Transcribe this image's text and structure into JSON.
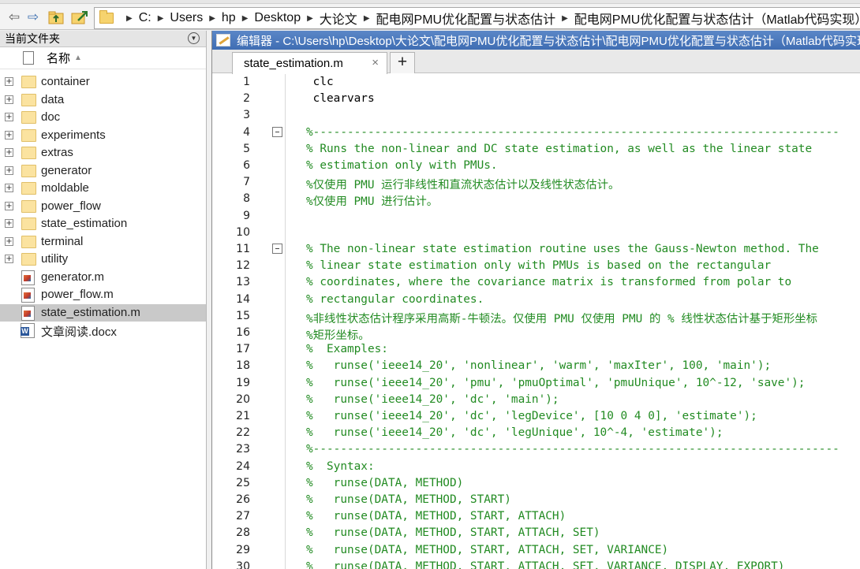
{
  "address_bar": {
    "crumbs": [
      "C:",
      "Users",
      "hp",
      "Desktop",
      "大论文",
      "配电网PMU优化配置与状态估计",
      "配电网PMU优化配置与状态估计（Matlab代码实现）"
    ]
  },
  "file_browser": {
    "title": "当前文件夹",
    "column_name": "名称",
    "items": [
      {
        "name": "container",
        "kind": "folder"
      },
      {
        "name": "data",
        "kind": "folder"
      },
      {
        "name": "doc",
        "kind": "folder"
      },
      {
        "name": "experiments",
        "kind": "folder"
      },
      {
        "name": "extras",
        "kind": "folder"
      },
      {
        "name": "generator",
        "kind": "folder"
      },
      {
        "name": "moldable",
        "kind": "folder"
      },
      {
        "name": "power_flow",
        "kind": "folder"
      },
      {
        "name": "state_estimation",
        "kind": "folder"
      },
      {
        "name": "terminal",
        "kind": "folder"
      },
      {
        "name": "utility",
        "kind": "folder"
      },
      {
        "name": "generator.m",
        "kind": "mfile"
      },
      {
        "name": "power_flow.m",
        "kind": "mfile"
      },
      {
        "name": "state_estimation.m",
        "kind": "mfile",
        "selected": true
      },
      {
        "name": "文章阅读.docx",
        "kind": "docx"
      }
    ]
  },
  "editor": {
    "title": "编辑器 - C:\\Users\\hp\\Desktop\\大论文\\配电网PMU优化配置与状态估计\\配电网PMU优化配置与状态估计（Matlab代码实现）",
    "tab_label": "state_estimation.m",
    "tab_close": "×",
    "tab_add": "+",
    "lines": [
      {
        "n": "1",
        "text": " clc",
        "comment": false
      },
      {
        "n": "2",
        "text": " clearvars",
        "comment": false
      },
      {
        "n": "3",
        "text": "",
        "comment": false
      },
      {
        "n": "4",
        "text": "%-----------------------------------------------------------------------------",
        "comment": true,
        "fold": true
      },
      {
        "n": "5",
        "text": "% Runs the non-linear and DC state estimation, as well as the linear state",
        "comment": true
      },
      {
        "n": "6",
        "text": "% estimation only with PMUs.",
        "comment": true
      },
      {
        "n": "7",
        "text": "%仅使用 PMU 运行非线性和直流状态估计以及线性状态估计。",
        "comment": true
      },
      {
        "n": "8",
        "text": "%仅使用 PMU 进行估计。",
        "comment": true
      },
      {
        "n": "9",
        "text": "",
        "comment": false
      },
      {
        "n": "10",
        "text": "",
        "comment": false
      },
      {
        "n": "11",
        "text": "% The non-linear state estimation routine uses the Gauss-Newton method. The",
        "comment": true,
        "fold": true
      },
      {
        "n": "12",
        "text": "% linear state estimation only with PMUs is based on the rectangular",
        "comment": true
      },
      {
        "n": "13",
        "text": "% coordinates, where the covariance matrix is transformed from polar to",
        "comment": true
      },
      {
        "n": "14",
        "text": "% rectangular coordinates.",
        "comment": true
      },
      {
        "n": "15",
        "text": "%非线性状态估计程序采用高斯-牛顿法。仅使用 PMU 仅使用 PMU 的 % 线性状态估计基于矩形坐标",
        "comment": true
      },
      {
        "n": "16",
        "text": "%矩形坐标。",
        "comment": true
      },
      {
        "n": "17",
        "text": "%  Examples:",
        "comment": true
      },
      {
        "n": "18",
        "text": "%   runse('ieee14_20', 'nonlinear', 'warm', 'maxIter', 100, 'main');",
        "comment": true
      },
      {
        "n": "19",
        "text": "%   runse('ieee14_20', 'pmu', 'pmuOptimal', 'pmuUnique', 10^-12, 'save');",
        "comment": true
      },
      {
        "n": "20",
        "text": "%   runse('ieee14_20', 'dc', 'main');",
        "comment": true
      },
      {
        "n": "21",
        "text": "%   runse('ieee14_20', 'dc', 'legDevice', [10 0 4 0], 'estimate');",
        "comment": true
      },
      {
        "n": "22",
        "text": "%   runse('ieee14_20', 'dc', 'legUnique', 10^-4, 'estimate');",
        "comment": true
      },
      {
        "n": "23",
        "text": "%-----------------------------------------------------------------------------",
        "comment": true
      },
      {
        "n": "24",
        "text": "%  Syntax:",
        "comment": true
      },
      {
        "n": "25",
        "text": "%   runse(DATA, METHOD)",
        "comment": true
      },
      {
        "n": "26",
        "text": "%   runse(DATA, METHOD, START)",
        "comment": true
      },
      {
        "n": "27",
        "text": "%   runse(DATA, METHOD, START, ATTACH)",
        "comment": true
      },
      {
        "n": "28",
        "text": "%   runse(DATA, METHOD, START, ATTACH, SET)",
        "comment": true
      },
      {
        "n": "29",
        "text": "%   runse(DATA, METHOD, START, ATTACH, SET, VARIANCE)",
        "comment": true
      },
      {
        "n": "30",
        "text": "%   runse(DATA, METHOD, START, ATTACH, SET, VARIANCE, DISPLAY, EXPORT)",
        "comment": true
      }
    ]
  }
}
